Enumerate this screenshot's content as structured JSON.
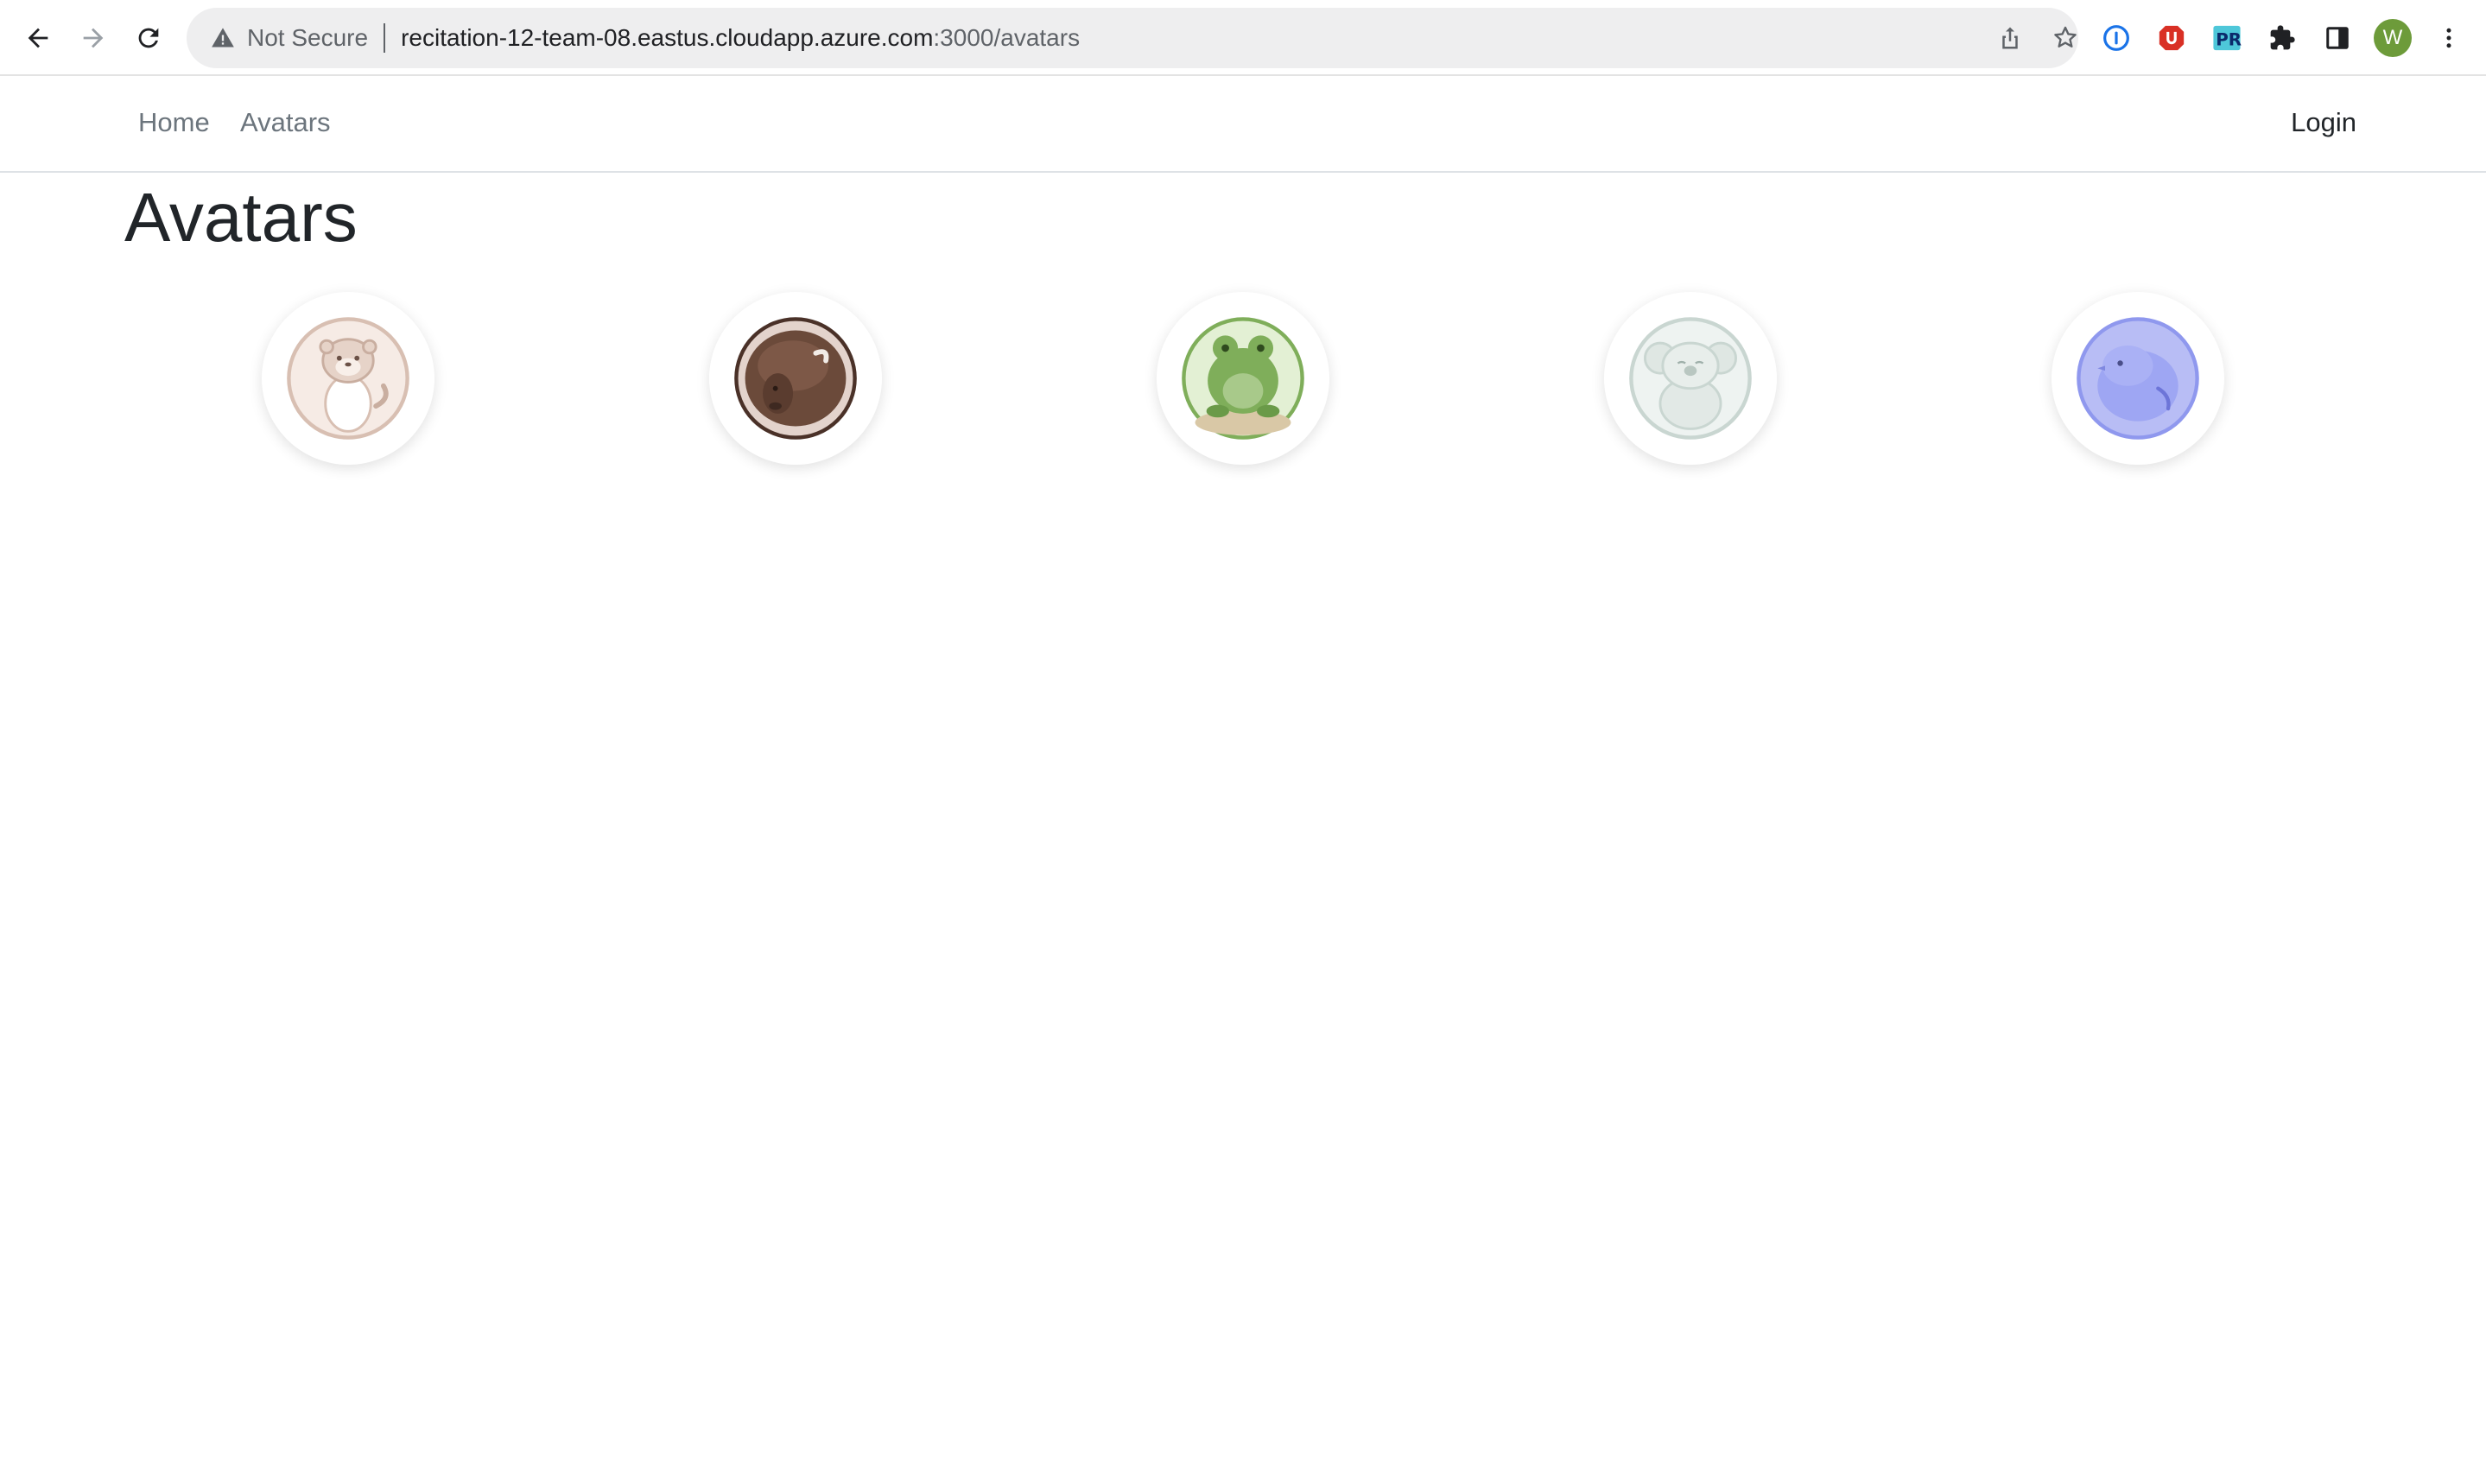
{
  "browser": {
    "security_label": "Not Secure",
    "url_host": "recitation-12-team-08.eastus.cloudapp.azure.com",
    "url_path": ":3000/avatars",
    "profile_initial": "W",
    "extensions": [
      "onepassword-icon",
      "ublock-icon",
      "pr-extension-icon",
      "puzzle-icon",
      "side-panel-icon"
    ]
  },
  "navbar": {
    "links": [
      {
        "label": "Home"
      },
      {
        "label": "Avatars"
      }
    ],
    "login_label": "Login"
  },
  "main": {
    "title": "Avatars",
    "avatars": [
      {
        "name": "otter",
        "color": "#d8bfb2"
      },
      {
        "name": "bison",
        "color": "#6b4a3a"
      },
      {
        "name": "frog",
        "color": "#7fae5a"
      },
      {
        "name": "koala",
        "color": "#c9d6d1"
      },
      {
        "name": "bird",
        "color": "#8f98ee"
      }
    ]
  }
}
